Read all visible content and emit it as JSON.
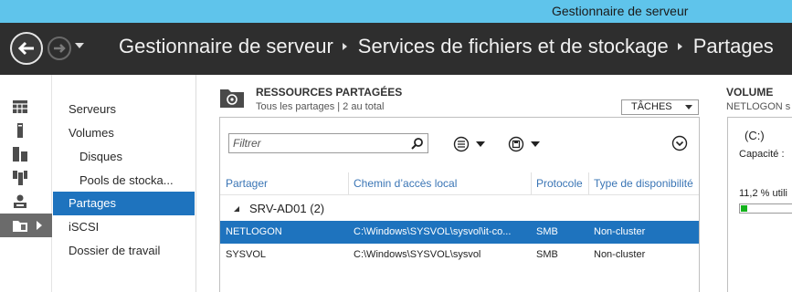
{
  "window": {
    "title": "Gestionnaire de serveur"
  },
  "header": {
    "breadcrumb": [
      "Gestionnaire de serveur",
      "Services de fichiers et de stockage",
      "Partages"
    ]
  },
  "nav": {
    "items": [
      {
        "label": "Serveurs"
      },
      {
        "label": "Volumes"
      },
      {
        "label": "Disques"
      },
      {
        "label": "Pools de stocka..."
      },
      {
        "label": "Partages"
      },
      {
        "label": "iSCSI"
      },
      {
        "label": "Dossier de travail"
      }
    ]
  },
  "shares": {
    "title": "RESSOURCES PARTAGÉES",
    "subtitle": "Tous les partages | 2 au total",
    "tasks_label": "TÂCHES",
    "filter_placeholder": "Filtrer",
    "columns": [
      "Partager",
      "Chemin d’accès local",
      "Protocole",
      "Type de disponibilité"
    ],
    "group": "SRV-AD01 (2)",
    "rows": [
      {
        "name": "NETLOGON",
        "path": "C:\\Windows\\SYSVOL\\sysvol\\it-co...",
        "protocol": "SMB",
        "availability": "Non-cluster"
      },
      {
        "name": "SYSVOL",
        "path": "C:\\Windows\\SYSVOL\\sysvol",
        "protocol": "SMB",
        "availability": "Non-cluster"
      }
    ]
  },
  "volume": {
    "title": "VOLUME",
    "subtitle": "NETLOGON s",
    "drive": "(C:)",
    "capacity_label": "Capacité :",
    "usage_label": "11,2 % utili",
    "usage_fraction": 0.112,
    "bar_color": "#15b31d"
  },
  "colors": {
    "accent": "#1e73be",
    "titlebar": "#5fc4eb",
    "header": "#2e2e2e"
  },
  "icons": {
    "rail": [
      "dashboard-icon",
      "local-server-icon",
      "all-servers-icon",
      "file-storage-icon",
      "ad-ds-icon",
      "shares-folder-icon"
    ]
  }
}
